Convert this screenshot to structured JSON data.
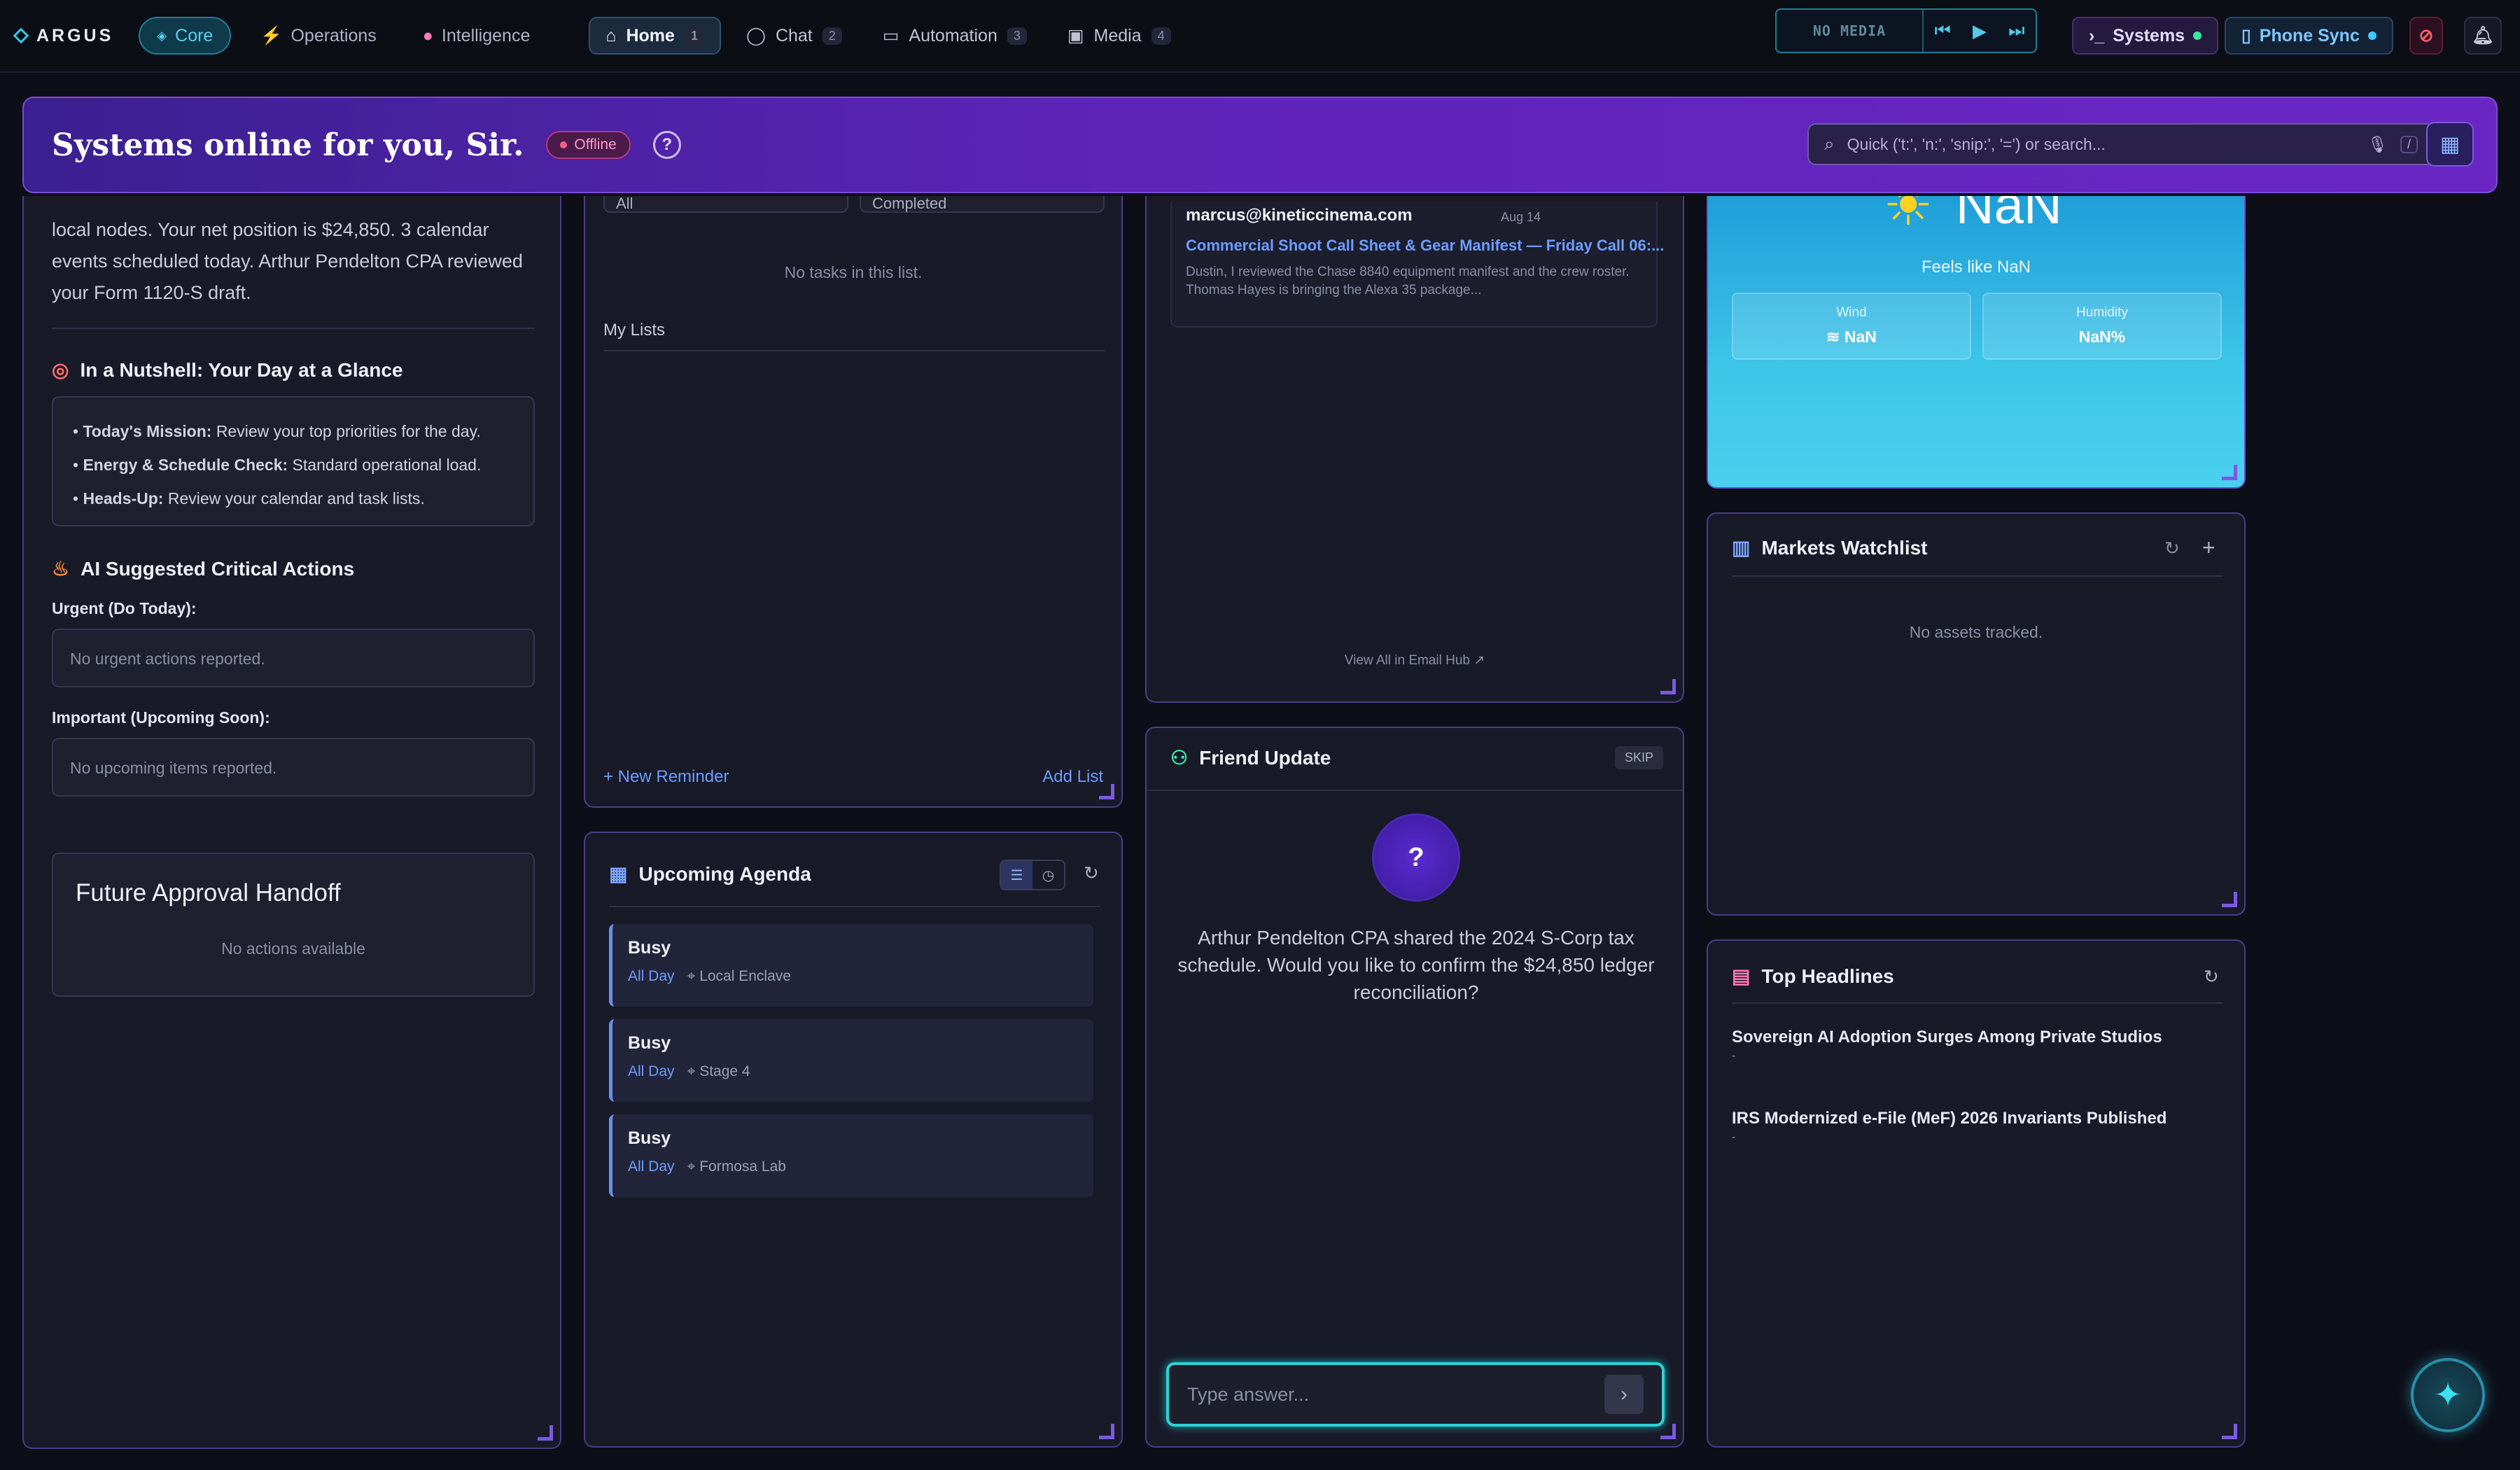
{
  "app": {
    "brand": "ARGUS"
  },
  "topnav": {
    "core": "Core",
    "operations": "Operations",
    "intelligence": "Intelligence",
    "tabs": [
      {
        "label": "Home",
        "badge": "1"
      },
      {
        "label": "Chat",
        "badge": "2"
      },
      {
        "label": "Automation",
        "badge": "3"
      },
      {
        "label": "Media",
        "badge": "4"
      }
    ]
  },
  "media": {
    "status": "NO MEDIA"
  },
  "status": {
    "systems": "Systems",
    "phone_sync": "Phone Sync"
  },
  "hero": {
    "greeting": "Systems online for you, Sir.",
    "offline": "Offline",
    "help": "?",
    "search_placeholder": "Quick ('t:', 'n:', 'snip:', '=') or search...",
    "search_hint": "/"
  },
  "briefing": {
    "summary": "local nodes. Your net position is $24,850. 3 calendar events scheduled today. Arthur Pendelton CPA reviewed your Form 1120-S draft.",
    "nutshell_title": "In a Nutshell: Your Day at a Glance",
    "bullets": [
      {
        "label": "Today's Mission:",
        "text": "Review your top priorities for the day."
      },
      {
        "label": "Energy & Schedule Check:",
        "text": "Standard operational load."
      },
      {
        "label": "Heads-Up:",
        "text": "Review your calendar and task lists."
      }
    ],
    "actions_title": "AI Suggested Critical Actions",
    "urgent_label": "Urgent (Do Today):",
    "urgent_text": "No urgent actions reported.",
    "important_label": "Important (Upcoming Soon):",
    "important_text": "No upcoming items reported.",
    "handoff_title": "Future Approval Handoff",
    "handoff_text": "No actions available"
  },
  "tasks": {
    "filter_all": "All",
    "filter_completed": "Completed",
    "empty": "No tasks in this list.",
    "my_lists": "My Lists",
    "new_reminder": "+ New Reminder",
    "add_list": "Add List"
  },
  "agenda": {
    "title": "Upcoming Agenda",
    "items": [
      {
        "title": "Busy",
        "when": "All Day",
        "location": "Local Enclave"
      },
      {
        "title": "Busy",
        "when": "All Day",
        "location": "Stage 4"
      },
      {
        "title": "Busy",
        "when": "All Day",
        "location": "Formosa Lab"
      }
    ]
  },
  "email": {
    "from": "marcus@kineticcinema.com",
    "date": "Aug 14",
    "subject": "Commercial Shoot Call Sheet & Gear Manifest — Friday Call 06:...",
    "preview": "Dustin, I reviewed the Chase 8840 equipment manifest and the crew roster. Thomas Hayes is bringing the Alexa 35 package...",
    "view_all": "View All in Email Hub"
  },
  "friend": {
    "title": "Friend Update",
    "skip": "SKIP",
    "avatar": "?",
    "message": "Arthur Pendelton CPA shared the 2024 S-Corp tax schedule. Would you like to confirm the $24,850 ledger reconciliation?",
    "answer_placeholder": "Type answer..."
  },
  "weather": {
    "temp": "NaN",
    "feels": "Feels like NaN",
    "wind_label": "Wind",
    "wind_value": "NaN",
    "humidity_label": "Humidity",
    "humidity_value": "NaN%"
  },
  "markets": {
    "title": "Markets Watchlist",
    "empty": "No assets tracked."
  },
  "headlines": {
    "title": "Top Headlines",
    "items": [
      {
        "title": "Sovereign AI Adoption Surges Among Private Studios",
        "meta": "-"
      },
      {
        "title": "IRS Modernized e-File (MeF) 2026 Invariants Published",
        "meta": "-"
      }
    ]
  },
  "colors": {
    "accent": "#7a5ae0",
    "cyan": "#38c6e6",
    "hero": "#5e24b8"
  }
}
